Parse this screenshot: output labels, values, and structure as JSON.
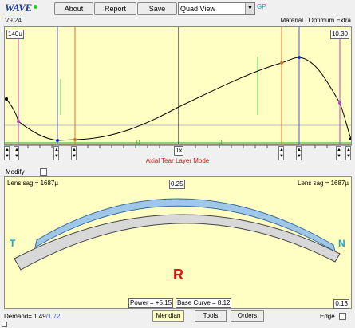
{
  "app": {
    "logo": "WAVE",
    "version": "V9.24",
    "gp_label": "GP"
  },
  "toolbar": {
    "about": "About",
    "report": "Report",
    "save": "Save",
    "view_select": "Quad View",
    "arrow": "▼"
  },
  "material": "Material : Optimum Extra",
  "top_plot": {
    "left_value": "140u",
    "right_value": "10.30",
    "center_label": "1x",
    "zero_left": "0",
    "zero_right": "0",
    "mode_label": "Axial Tear Layer Mode"
  },
  "modify_label": "Modify",
  "bottom_plot": {
    "sag_left": "Lens sag = 1687µ",
    "sag_right": "Lens sag = 1687µ",
    "top_value": "0.25",
    "temporal": "T",
    "nasal": "N",
    "meridian_letter": "R",
    "power": "Power = +5.15",
    "base_curve": "Base Curve = 8.12",
    "edge_value": "0.13"
  },
  "status_bar": {
    "demand_label": "Demand= 1.49",
    "demand_extra": "/1.72",
    "meridian": "Meridian",
    "tools": "Tools",
    "orders": "Orders",
    "edge": "Edge"
  },
  "colors": {
    "plot_bg": "#ffffc4",
    "accent_red": "#d11",
    "accent_cyan": "#1aa7c8",
    "lens_blue": "#9fc7e8"
  }
}
